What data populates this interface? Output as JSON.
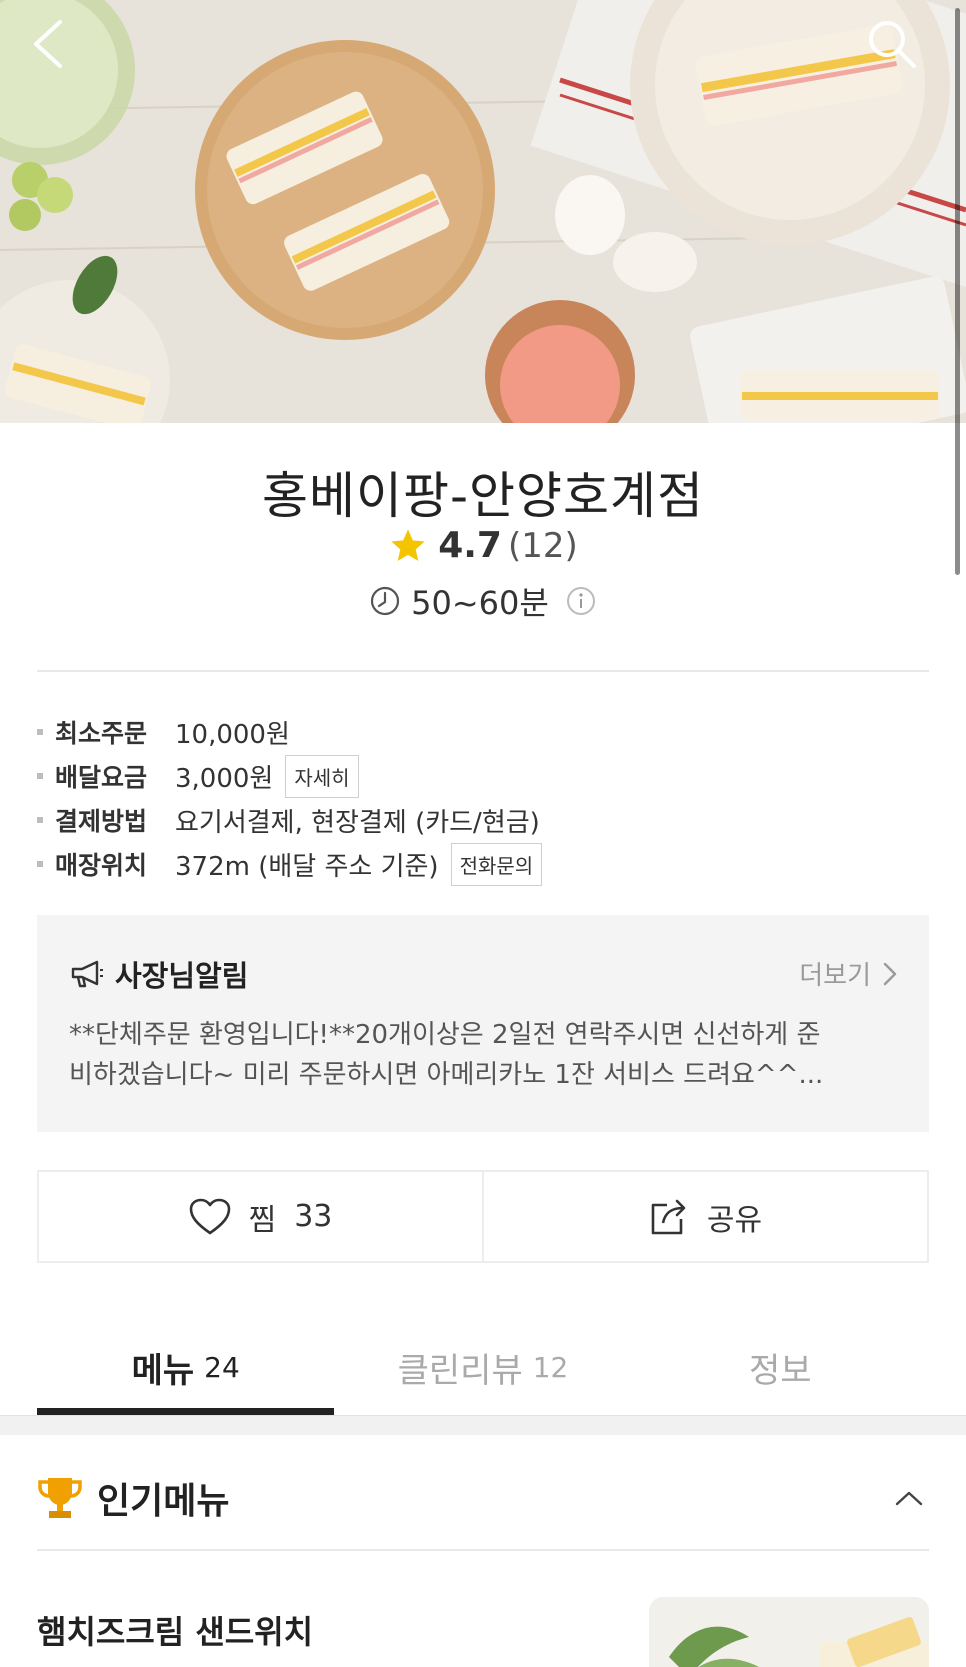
{
  "store": {
    "name": "홍베이팡-안양호계점",
    "rating": "4.7",
    "review_count": "(12)",
    "delivery_time": "50~60분"
  },
  "info": {
    "min_order_label": "최소주문",
    "min_order_value": "10,000원",
    "delivery_fee_label": "배달요금",
    "delivery_fee_value": "3,000원",
    "delivery_fee_tag": "자세히",
    "payment_label": "결제방법",
    "payment_value": "요기서결제, 현장결제 (카드/현금)",
    "location_label": "매장위치",
    "location_value": "372m (배달 주소 기준)",
    "location_tag": "전화문의"
  },
  "notice": {
    "title": "사장님알림",
    "more": "더보기",
    "body_line1": "**단체주문 환영입니다!**20개이상은 2일전 연락주시면 신선하게 준",
    "body_line2": "비하겠습니다~ 미리 주문하시면 아메리카노 1잔 서비스 드려요^^..."
  },
  "actions": {
    "like_label": "찜",
    "like_count": "33",
    "share_label": "공유"
  },
  "tabs": [
    {
      "label": "메뉴",
      "count": "24"
    },
    {
      "label": "클린리뷰",
      "count": "12"
    },
    {
      "label": "정보",
      "count": ""
    }
  ],
  "popular": {
    "title": "인기메뉴",
    "first_item": "햄치즈크림 샌드위치"
  },
  "colors": {
    "star": "#f5c400",
    "trophy": "#f0a000",
    "active_tab": "#222222",
    "inactive_tab": "#aaaaaa"
  },
  "icons": [
    "back-arrow-icon",
    "search-icon",
    "star-icon",
    "clock-icon",
    "info-icon",
    "megaphone-icon",
    "chevron-right-icon",
    "heart-icon",
    "share-icon",
    "trophy-icon",
    "chevron-up-icon"
  ]
}
